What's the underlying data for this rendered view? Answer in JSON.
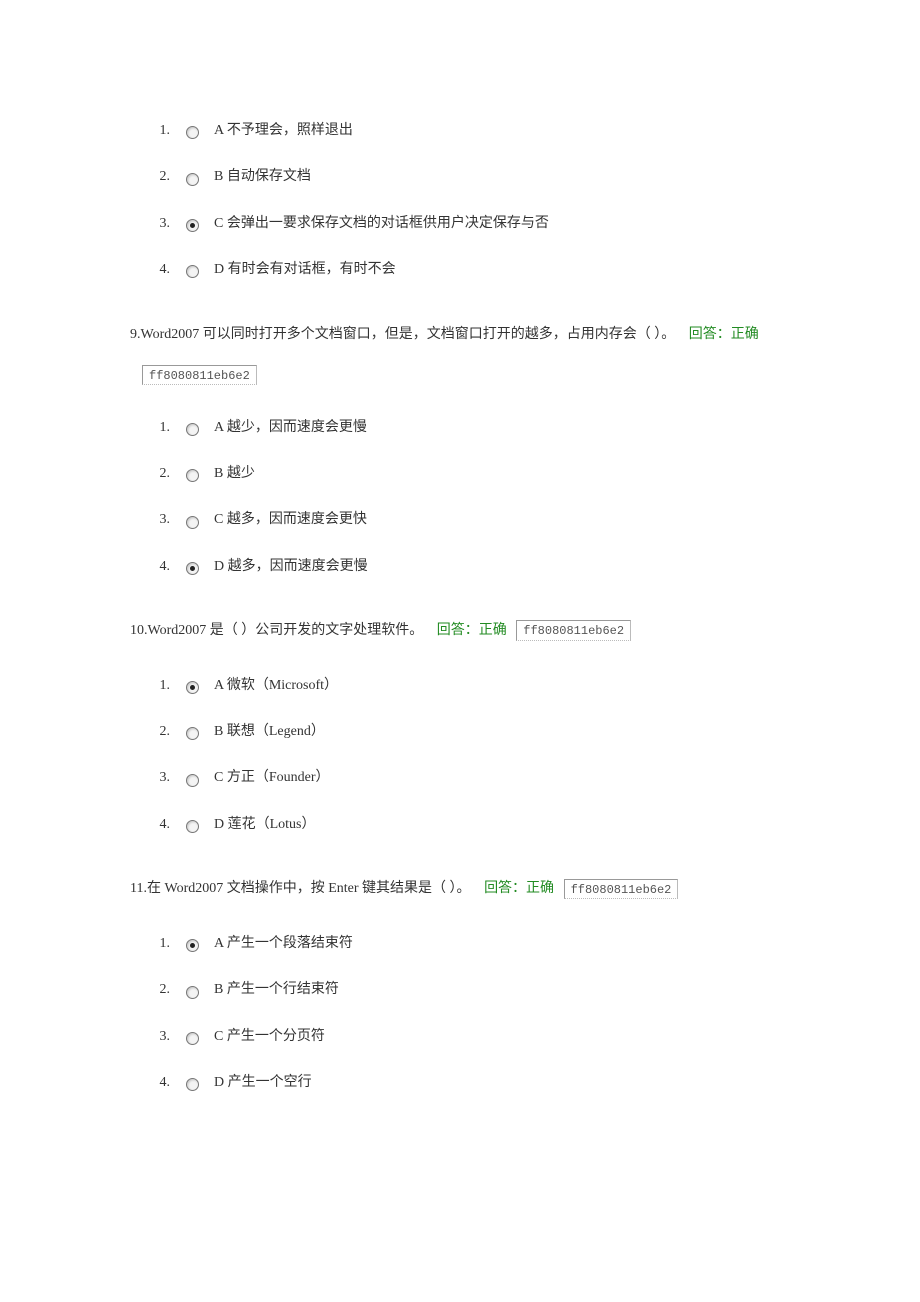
{
  "q8": {
    "options": [
      {
        "num": "1.",
        "text": "A 不予理会，照样退出",
        "selected": false
      },
      {
        "num": "2.",
        "text": "B 自动保存文档",
        "selected": false
      },
      {
        "num": "3.",
        "text": "C 会弹出一要求保存文档的对话框供用户决定保存与否",
        "selected": true
      },
      {
        "num": "4.",
        "text": "D 有时会有对话框，有时不会",
        "selected": false
      }
    ]
  },
  "q9": {
    "stem": "9.Word2007 可以同时打开多个文档窗口，但是，文档窗口打开的越多，占用内存会（ ）。",
    "feedback": "回答：正确",
    "id": "ff8080811eb6e2",
    "options": [
      {
        "num": "1.",
        "text": "A 越少，因而速度会更慢",
        "selected": false
      },
      {
        "num": "2.",
        "text": "B 越少",
        "selected": false
      },
      {
        "num": "3.",
        "text": "C 越多，因而速度会更快",
        "selected": false
      },
      {
        "num": "4.",
        "text": "D 越多，因而速度会更慢",
        "selected": true
      }
    ]
  },
  "q10": {
    "stem": "10.Word2007 是（ ）公司开发的文字处理软件。",
    "feedback": "回答：正确",
    "id": "ff8080811eb6e2",
    "options": [
      {
        "num": "1.",
        "text": "A 微软（Microsoft）",
        "selected": true
      },
      {
        "num": "2.",
        "text": "B 联想（Legend）",
        "selected": false
      },
      {
        "num": "3.",
        "text": "C 方正（Founder）",
        "selected": false
      },
      {
        "num": "4.",
        "text": "D 莲花（Lotus）",
        "selected": false
      }
    ]
  },
  "q11": {
    "stem": "11.在 Word2007 文档操作中，按 Enter 键其结果是（ ）。",
    "feedback": "回答：正确",
    "id": "ff8080811eb6e2",
    "options": [
      {
        "num": "1.",
        "text": "A 产生一个段落结束符",
        "selected": true
      },
      {
        "num": "2.",
        "text": "B 产生一个行结束符",
        "selected": false
      },
      {
        "num": "3.",
        "text": "C 产生一个分页符",
        "selected": false
      },
      {
        "num": "4.",
        "text": "D 产生一个空行",
        "selected": false
      }
    ]
  }
}
